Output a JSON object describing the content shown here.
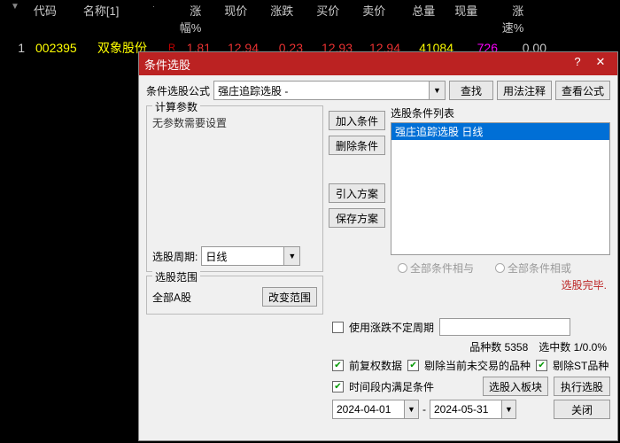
{
  "table": {
    "headers": {
      "code": "代码",
      "name": "名称[1]",
      "pct": "涨幅%",
      "price": "现价",
      "chg": "涨跌",
      "bid": "买价",
      "ask": "卖价",
      "vol": "总量",
      "now": "现量",
      "speed": "涨速%"
    },
    "row": {
      "idx": "1",
      "code": "002395",
      "name": "双象股份",
      "r": "R",
      "pct": "1.81",
      "price": "12.94",
      "chg": "0.23",
      "bid": "12.93",
      "ask": "12.94",
      "vol": "41084",
      "now": "726",
      "speed": "0.00"
    }
  },
  "dialog": {
    "title": "条件选股",
    "formula_label": "条件选股公式",
    "formula_value": "强庄追踪选股 -",
    "btn_find": "查找",
    "btn_usage": "用法注释",
    "btn_view": "查看公式",
    "params_legend": "计算参数",
    "params_text": "无参数需要设置",
    "period_label": "选股周期:",
    "period_value": "日线",
    "btn_add": "加入条件",
    "btn_del": "删除条件",
    "btn_import": "引入方案",
    "btn_save": "保存方案",
    "list_label": "选股条件列表",
    "list_item": "强庄追踪选股   日线",
    "radio_and": "全部条件相与",
    "radio_or": "全部条件相或",
    "status": "选股完毕.",
    "scope_legend": "选股范围",
    "scope_text": "全部A股",
    "btn_scope": "改变范围",
    "chk_unstable": "使用涨跌不定周期",
    "count_label1": "品种数",
    "count_val1": "5358",
    "count_label2": "选中数",
    "count_val2": "1/0.0%",
    "chk_fq": "前复权数据",
    "chk_remove_notrade": "剔除当前未交易的品种",
    "chk_remove_st": "剔除ST品种",
    "chk_timespan": "时间段内满足条件",
    "btn_toblock": "选股入板块",
    "btn_execute": "执行选股",
    "date_from": "2024-04-01",
    "date_to": "2024-05-31",
    "date_sep": "-",
    "btn_close": "关闭"
  }
}
